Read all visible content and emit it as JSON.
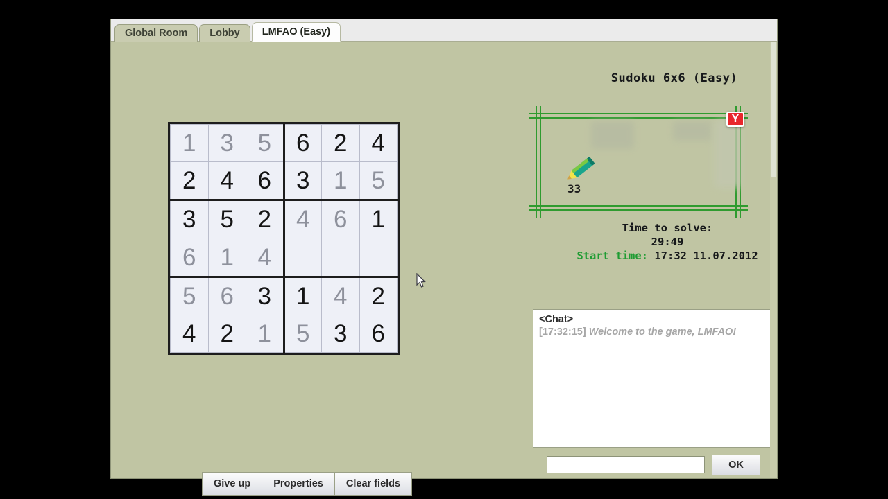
{
  "window": {
    "tabs": [
      {
        "label": "Global Room",
        "active": false
      },
      {
        "label": "Lobby",
        "active": false
      },
      {
        "label": "LMFAO (Easy)",
        "active": true
      }
    ]
  },
  "puzzle": {
    "title": "Sudoku 6x6  (Easy)",
    "rows": 6,
    "cols": 6,
    "cells": [
      [
        {
          "v": "1",
          "s": "entered"
        },
        {
          "v": "3",
          "s": "entered"
        },
        {
          "v": "5",
          "s": "entered"
        },
        {
          "v": "6",
          "s": "given"
        },
        {
          "v": "2",
          "s": "given"
        },
        {
          "v": "4",
          "s": "given"
        }
      ],
      [
        {
          "v": "2",
          "s": "given"
        },
        {
          "v": "4",
          "s": "given"
        },
        {
          "v": "6",
          "s": "given"
        },
        {
          "v": "3",
          "s": "given"
        },
        {
          "v": "1",
          "s": "entered"
        },
        {
          "v": "5",
          "s": "entered"
        }
      ],
      [
        {
          "v": "3",
          "s": "given"
        },
        {
          "v": "5",
          "s": "given"
        },
        {
          "v": "2",
          "s": "given"
        },
        {
          "v": "4",
          "s": "entered"
        },
        {
          "v": "6",
          "s": "entered"
        },
        {
          "v": "1",
          "s": "given"
        }
      ],
      [
        {
          "v": "6",
          "s": "entered"
        },
        {
          "v": "1",
          "s": "entered"
        },
        {
          "v": "4",
          "s": "entered"
        },
        {
          "v": "",
          "s": "empty"
        },
        {
          "v": "",
          "s": "empty"
        },
        {
          "v": "",
          "s": "empty"
        }
      ],
      [
        {
          "v": "5",
          "s": "entered"
        },
        {
          "v": "6",
          "s": "entered"
        },
        {
          "v": "3",
          "s": "given"
        },
        {
          "v": "1",
          "s": "given"
        },
        {
          "v": "4",
          "s": "entered"
        },
        {
          "v": "2",
          "s": "given"
        }
      ],
      [
        {
          "v": "4",
          "s": "given"
        },
        {
          "v": "2",
          "s": "given"
        },
        {
          "v": "1",
          "s": "entered"
        },
        {
          "v": "5",
          "s": "entered"
        },
        {
          "v": "3",
          "s": "given"
        },
        {
          "v": "6",
          "s": "given"
        }
      ]
    ]
  },
  "ad": {
    "badge_label": "Y",
    "pencil_count": "33"
  },
  "timer": {
    "time_label": "Time to solve:",
    "time_value": "29:49",
    "start_label": "Start time:",
    "start_value": "17:32 11.07.2012"
  },
  "chat": {
    "header": "<Chat>",
    "message_time": "[17:32:15]",
    "message_text": " Welcome to the game, LMFAO!",
    "input_value": "",
    "input_placeholder": "",
    "ok_label": "OK"
  },
  "toolbar": {
    "giveup_label": "Give up",
    "properties_label": "Properties",
    "clear_label": "Clear fields"
  },
  "colors": {
    "background": "#c0c5a3",
    "cell_bg": "#eef0f7",
    "given_text": "#141414",
    "entered_text": "#8e919c",
    "frame_green": "#2f9b2f",
    "start_time_green": "#1f9c33",
    "badge_red": "#e8272c"
  }
}
